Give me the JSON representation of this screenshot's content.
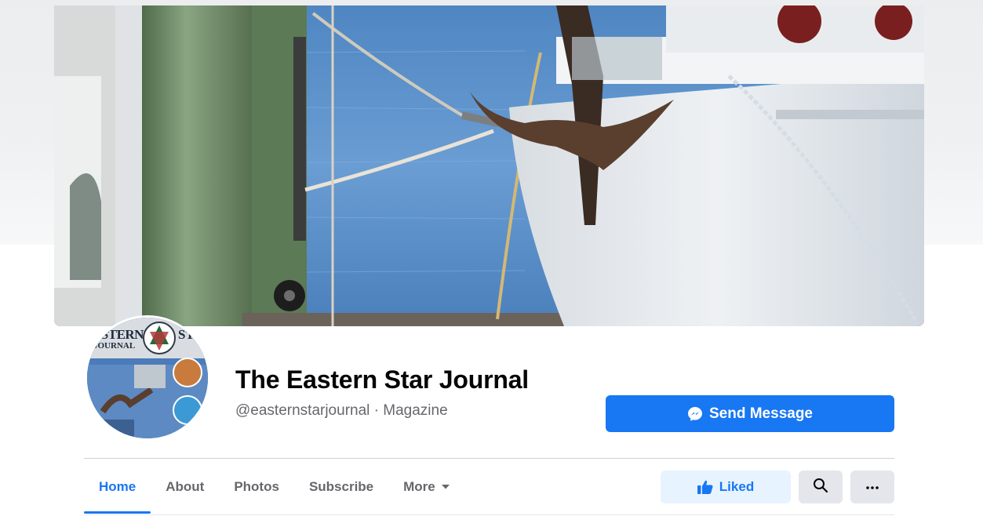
{
  "page": {
    "name": "The Eastern Star Journal",
    "subtitle": "@easternstarjournal · Magazine"
  },
  "actions": {
    "send_message": "Send Message",
    "liked": "Liked"
  },
  "tabs": [
    {
      "label": "Home",
      "active": true
    },
    {
      "label": "About",
      "active": false
    },
    {
      "label": "Photos",
      "active": false
    },
    {
      "label": "Subscribe",
      "active": false
    },
    {
      "label": "More",
      "active": false
    }
  ],
  "avatar": {
    "logo_text_left": "ASTERN",
    "logo_text_right": "STA",
    "logo_text_sub": "JOURNAL"
  },
  "icons": {
    "send_message": "messenger-icon",
    "liked": "thumbs-up-icon",
    "search": "search-icon",
    "more": "ellipsis-icon",
    "more_tab": "caret-down-icon"
  },
  "colors": {
    "accent": "#1877f2",
    "accent_light": "#e7f3ff",
    "secondary_button": "#e4e6eb",
    "text_primary": "#050505",
    "text_secondary": "#65676b"
  }
}
